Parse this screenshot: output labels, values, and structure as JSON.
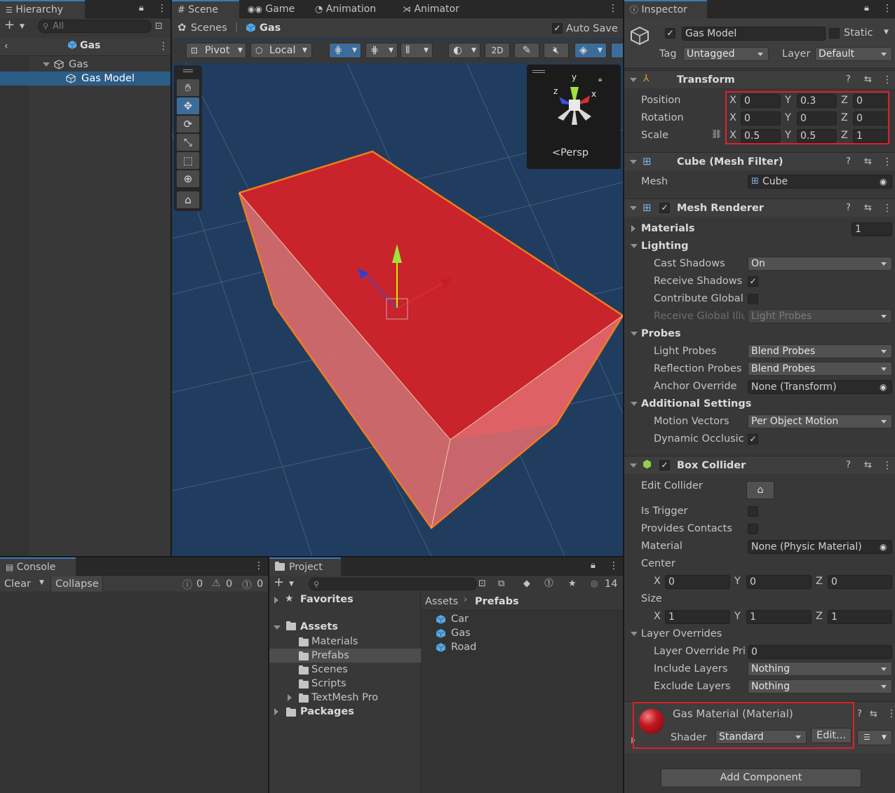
{
  "hierarchy": {
    "tab_label": "Hierarchy",
    "search_placeholder": "All",
    "breadcrumb": "Gas",
    "items": [
      {
        "label": "Gas"
      },
      {
        "label": "Gas Model"
      }
    ]
  },
  "scene": {
    "tabs": [
      {
        "label": "Scene"
      },
      {
        "label": "Game"
      },
      {
        "label": "Animation"
      },
      {
        "label": "Animator"
      }
    ],
    "breadcrumb_root": "Scenes",
    "breadcrumb_current": "Gas",
    "auto_save_label": "Auto Save",
    "toolbar": {
      "pivot": "Pivot",
      "local": "Local",
      "mode_2d": "2D"
    },
    "gizmo_persp": "Persp",
    "gizmo_axes": {
      "y": "y",
      "x": "x",
      "z": "z"
    },
    "colors": {
      "background": "#1f3a5c",
      "selection": "#f07c1c",
      "object": "#d42a30"
    }
  },
  "inspector": {
    "tab_label": "Inspector",
    "object_name": "Gas Model",
    "static_label": "Static",
    "tag_label": "Tag",
    "tag_value": "Untagged",
    "layer_label": "Layer",
    "layer_value": "Default",
    "transform": {
      "title": "Transform",
      "rows": [
        {
          "label": "Position",
          "x": "0",
          "y": "0.3",
          "z": "0"
        },
        {
          "label": "Rotation",
          "x": "0",
          "y": "0",
          "z": "0"
        },
        {
          "label": "Scale",
          "x": "0.5",
          "y": "0.5",
          "z": "1"
        }
      ]
    },
    "mesh_filter": {
      "title": "Cube (Mesh Filter)",
      "mesh_label": "Mesh",
      "mesh_value": "Cube"
    },
    "mesh_renderer": {
      "title": "Mesh Renderer",
      "materials_label": "Materials",
      "materials_count": "1",
      "lighting_label": "Lighting",
      "cast_shadows_label": "Cast Shadows",
      "cast_shadows_value": "On",
      "receive_shadows_label": "Receive Shadows",
      "contribute_gi_label": "Contribute Global",
      "receive_gi_label": "Receive Global Illu",
      "receive_gi_value": "Light Probes",
      "probes_label": "Probes",
      "light_probes_label": "Light Probes",
      "light_probes_value": "Blend Probes",
      "reflection_probes_label": "Reflection Probes",
      "reflection_probes_value": "Blend Probes",
      "anchor_override_label": "Anchor Override",
      "anchor_override_value": "None (Transform)",
      "additional_settings_label": "Additional Settings",
      "motion_vectors_label": "Motion Vectors",
      "motion_vectors_value": "Per Object Motion",
      "dynamic_occlusion_label": "Dynamic Occlusic"
    },
    "box_collider": {
      "title": "Box Collider",
      "edit_collider_label": "Edit Collider",
      "is_trigger_label": "Is Trigger",
      "provides_contacts_label": "Provides Contacts",
      "material_label": "Material",
      "material_value": "None (Physic Material)",
      "center_label": "Center",
      "center": {
        "x": "0",
        "y": "0",
        "z": "0"
      },
      "size_label": "Size",
      "size": {
        "x": "1",
        "y": "1",
        "z": "1"
      },
      "layer_overrides_label": "Layer Overrides",
      "layer_override_priority_label": "Layer Override Pri",
      "layer_override_priority_value": "0",
      "include_layers_label": "Include Layers",
      "include_layers_value": "Nothing",
      "exclude_layers_label": "Exclude Layers",
      "exclude_layers_value": "Nothing"
    },
    "material": {
      "title": "Gas Material (Material)",
      "shader_label": "Shader",
      "shader_value": "Standard",
      "edit_label": "Edit...",
      "color": "#c41820"
    },
    "add_component_label": "Add Component"
  },
  "console": {
    "tab_label": "Console",
    "clear_label": "Clear",
    "collapse_label": "Collapse",
    "info_count": "0",
    "warn_count": "0",
    "error_count": "0"
  },
  "project": {
    "tab_label": "Project",
    "hidden_count": "14",
    "favorites_label": "Favorites",
    "assets_label": "Assets",
    "folders": [
      {
        "label": "Materials"
      },
      {
        "label": "Prefabs"
      },
      {
        "label": "Scenes"
      },
      {
        "label": "Scripts"
      },
      {
        "label": "TextMesh Pro"
      }
    ],
    "packages_label": "Packages",
    "breadcrumb_root": "Assets",
    "breadcrumb_current": "Prefabs",
    "files": [
      {
        "label": "Car"
      },
      {
        "label": "Gas"
      },
      {
        "label": "Road"
      }
    ]
  }
}
